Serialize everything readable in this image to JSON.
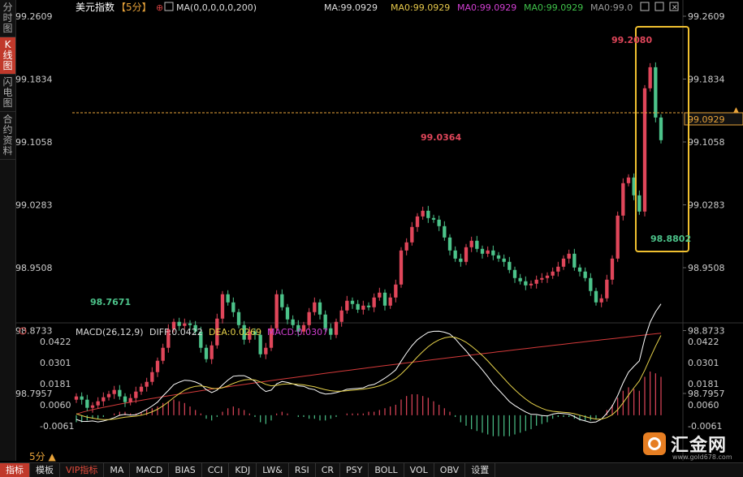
{
  "sidebar": {
    "tabs": [
      "分时图",
      "K线图",
      "闪电图",
      "合约资料"
    ],
    "active": 1
  },
  "header": {
    "symbol": "美元指数",
    "period_tag": "【5分】",
    "ma_label": "MA(0,0,0,0,0,200)",
    "ma_values": [
      {
        "text": "MA:99.0929",
        "color": "#dddddd"
      },
      {
        "text": "MA0:99.0929",
        "color": "#e6c84a"
      },
      {
        "text": "MA0:99.0929",
        "color": "#d23fd2"
      },
      {
        "text": "MA0:99.0929",
        "color": "#3fc24a"
      },
      {
        "text": "MA0:99.0",
        "color": "#9a9a9a"
      }
    ]
  },
  "macd_header": {
    "label": "MACD(26,12,9)",
    "diff": "DIFF:0.0422",
    "dea": "DEA:0.0269",
    "macd": "MACD:0.0307"
  },
  "chart_data": {
    "type": "candlestick",
    "price_ticks": [
      "99.2609",
      "99.1834",
      "99.1058",
      "99.0283",
      "98.9508",
      "98.8733",
      "98.7957"
    ],
    "macd_ticks": [
      "0.0422",
      "0.0301",
      "0.0181",
      "0.0060",
      "-0.0061"
    ],
    "current_price": "99.0929",
    "annotations": {
      "high": "99.2080",
      "local_high": "99.0364",
      "low_start": "98.7671",
      "low_spike": "98.8802"
    },
    "ma200_start": 98.77,
    "ma200_end": 98.87,
    "closes": [
      98.792,
      98.788,
      98.778,
      98.781,
      98.786,
      98.791,
      98.795,
      98.8,
      98.792,
      98.785,
      98.79,
      98.798,
      98.804,
      98.81,
      98.822,
      98.836,
      98.852,
      98.875,
      98.884,
      98.879,
      98.882,
      98.88,
      98.872,
      98.852,
      98.838,
      98.855,
      98.888,
      98.918,
      98.908,
      98.896,
      98.88,
      98.862,
      98.872,
      98.868,
      98.844,
      98.852,
      98.876,
      98.918,
      98.902,
      98.887,
      98.88,
      98.872,
      98.88,
      98.896,
      98.908,
      98.893,
      98.876,
      98.868,
      98.884,
      98.898,
      98.91,
      98.906,
      98.899,
      98.904,
      98.902,
      98.914,
      98.92,
      98.904,
      98.914,
      98.93,
      98.972,
      98.982,
      99.001,
      99.014,
      99.021,
      99.012,
      99.01,
      99.002,
      98.988,
      98.972,
      98.962,
      98.958,
      98.976,
      98.984,
      98.974,
      98.968,
      98.972,
      98.966,
      98.962,
      98.958,
      98.948,
      98.938,
      98.934,
      98.929,
      98.931,
      98.936,
      98.938,
      98.941,
      98.946,
      98.952,
      98.962,
      98.968,
      98.951,
      98.946,
      98.938,
      98.922,
      98.908,
      98.913,
      98.936,
      98.962,
      99.015,
      99.055,
      99.062,
      99.04,
      99.02,
      99.172,
      99.198,
      99.136,
      99.108
    ],
    "hist": [
      -0.004,
      -0.004,
      -0.003,
      -0.002,
      -0.002,
      -0.001,
      0,
      0.001,
      0.002,
      0.002,
      0.001,
      0.001,
      0.002,
      0.003,
      0.004,
      0.005,
      0.007,
      0.008,
      0.009,
      0.008,
      0.007,
      0.005,
      0.003,
      0.001,
      -0.002,
      -0.003,
      -0.001,
      0.002,
      0.004,
      0.005,
      0.004,
      0.003,
      0.001,
      -0.001,
      -0.004,
      -0.005,
      -0.003,
      0.001,
      0.002,
      0.001,
      0,
      -0.001,
      -0.001,
      -0.002,
      -0.002,
      -0.003,
      -0.003,
      -0.002,
      -0.001,
      0,
      0.001,
      0.001,
      0.001,
      0.001,
      0.002,
      0.002,
      0.003,
      0.004,
      0.005,
      0.006,
      0.009,
      0.011,
      0.012,
      0.012,
      0.011,
      0.01,
      0.008,
      0.006,
      0.004,
      0.002,
      -0.001,
      -0.004,
      -0.006,
      -0.008,
      -0.009,
      -0.01,
      -0.011,
      -0.012,
      -0.012,
      -0.012,
      -0.012,
      -0.011,
      -0.01,
      -0.009,
      -0.008,
      -0.006,
      -0.005,
      -0.004,
      -0.002,
      -0.001,
      -0.001,
      -0.001,
      -0.002,
      -0.003,
      -0.003,
      -0.003,
      -0.002,
      0,
      0.003,
      0.006,
      0.01,
      0.014,
      0.016,
      0.015,
      0.014,
      0.022,
      0.025,
      0.024,
      0.022
    ]
  },
  "toolbar": {
    "period": "5分 ▲",
    "items": [
      "指标",
      "模板",
      "VIP指标",
      "MA",
      "MACD",
      "BIAS",
      "CCI",
      "KDJ",
      "LW&",
      "RSI",
      "CR",
      "PSY",
      "BOLL",
      "VOL",
      "OBV",
      "设置"
    ]
  },
  "logo": {
    "name": "汇金网",
    "url": "www.gold678.com"
  },
  "colors": {
    "up": "#e0465a",
    "down": "#4cc38a",
    "ma200": "#d43a3a",
    "diff": "#ffffff",
    "dea": "#e6d24a",
    "highlight": "#f0c030"
  }
}
